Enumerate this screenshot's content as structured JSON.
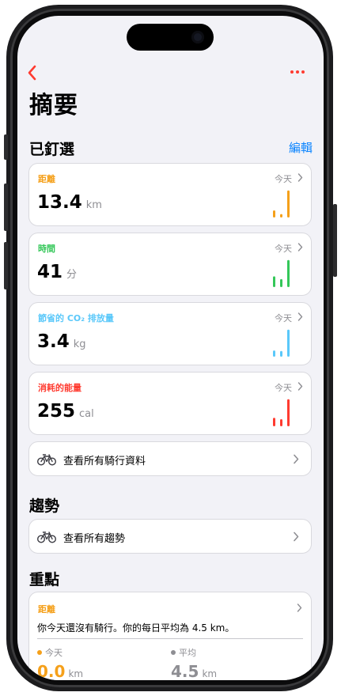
{
  "nav": {
    "title": "摘要"
  },
  "pinned": {
    "title": "已釘選",
    "edit_label": "編輯",
    "metrics": [
      {
        "label": "距離",
        "when": "今天",
        "value": "13.4",
        "unit": "km",
        "color": "#f5a01a",
        "bars": [
          0.25,
          0.12,
          0.95
        ]
      },
      {
        "label": "時間",
        "when": "今天",
        "value": "41",
        "unit": "分",
        "color": "#34c759",
        "bars": [
          0.38,
          0.28,
          0.95
        ]
      },
      {
        "label": "節省的 CO₂ 排放量",
        "when": "今天",
        "value": "3.4",
        "unit": "kg",
        "color": "#5ac8fa",
        "bars": [
          0.22,
          0.2,
          0.95
        ]
      },
      {
        "label": "消耗的能量",
        "when": "今天",
        "value": "255",
        "unit": "cal",
        "color": "#ff3b30",
        "bars": [
          0.3,
          0.25,
          0.95
        ]
      }
    ],
    "all_rides_label": "查看所有騎行資料"
  },
  "trends": {
    "title": "趨勢",
    "all_trends_label": "查看所有趨勢"
  },
  "highlights": {
    "title": "重點",
    "label": "距離",
    "text": "你今天還沒有騎行。你的每日平均為 4.5 km。",
    "today_label": "今天",
    "today_value": "0.0",
    "avg_label": "平均",
    "avg_value": "4.5",
    "unit": "km",
    "today_color": "#f5a01a",
    "avg_color": "#8e8e93"
  },
  "icons": {
    "back": "chevron-left-icon",
    "more": "ellipsis-icon",
    "bike": "bicycle-icon",
    "disclosure": "chevron-right-icon"
  },
  "accent": "#ff3b30",
  "link_color": "#0a84ff"
}
